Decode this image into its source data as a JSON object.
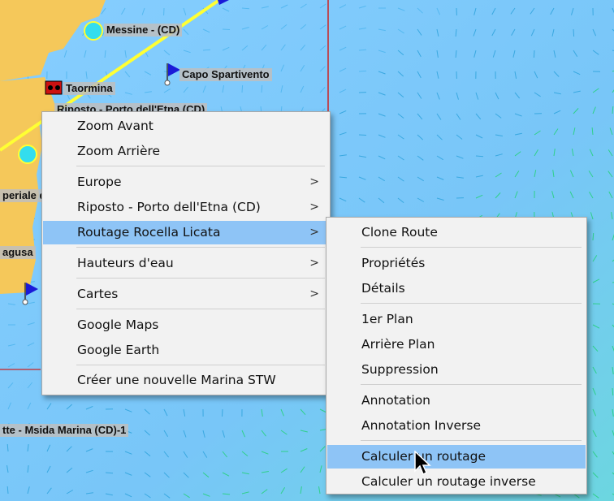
{
  "map": {
    "labels": {
      "messine": "Messine -  (CD)",
      "capo": "Capo Spartivento",
      "taormina": "Taormina",
      "riposto_under": "Riposto -  Porto dell'Etna (CD)",
      "imperiale": "periale d",
      "ragusa": "agusa",
      "msida": "tte - Msida Marina (CD)-1"
    }
  },
  "context_menu": {
    "items": [
      {
        "label": "Zoom Avant"
      },
      {
        "label": "Zoom Arrière"
      },
      {
        "label": "Europe",
        "submenu": true
      },
      {
        "label": "Riposto  - Porto dell'Etna (CD)",
        "submenu": true
      },
      {
        "label": "Routage Rocella Licata",
        "submenu": true,
        "highlighted": true
      },
      {
        "label": "Hauteurs d'eau",
        "submenu": true
      },
      {
        "label": "Cartes",
        "submenu": true
      },
      {
        "label": "Google Maps"
      },
      {
        "label": "Google Earth"
      },
      {
        "label": "Créer une nouvelle Marina STW"
      }
    ],
    "arrow": ">"
  },
  "submenu": {
    "items": [
      {
        "label": "Clone Route"
      },
      {
        "label": "Propriétés"
      },
      {
        "label": "Détails"
      },
      {
        "label": "1er Plan"
      },
      {
        "label": "Arrière Plan"
      },
      {
        "label": "Suppression"
      },
      {
        "label": "Annotation"
      },
      {
        "label": "Annotation Inverse"
      },
      {
        "label": "Calculer un routage",
        "highlighted": true
      },
      {
        "label": "Calculer un routage inverse"
      }
    ]
  },
  "colors": {
    "sea": "#7ec8ff",
    "land": "#f5c85a",
    "highlight": "#8ec4f6",
    "route": "#ffff33",
    "flag": "#1a1ad8"
  }
}
